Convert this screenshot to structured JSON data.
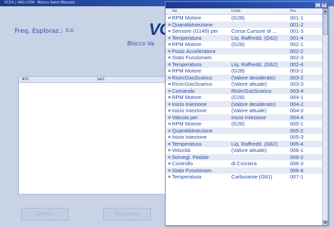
{
  "main": {
    "title": "VCDS | VAG-COM - Blocco Valori Misurati",
    "freq_label": "Freq. Esploraz.:",
    "freq_value": "0.0",
    "brand_text": "VC",
    "block_label": "Blocco Va",
    "table_headers": [
      "#01",
      "Val2"
    ],
    "button_left": "Grafico",
    "button_right": "Registrare"
  },
  "list_window": {
    "title": "",
    "close_icon": "×",
    "minimize_icon": "_",
    "columns": [
      "Val",
      "Unità",
      "Pos"
    ],
    "rows": [
      {
        "name": "RPM Motore",
        "value": "(G28)",
        "pos": "001-1"
      },
      {
        "name": "QuantitàIniezione",
        "value": "",
        "pos": "001-2"
      },
      {
        "name": "Sensore (G149) per",
        "value": "Corsa Cursore di ...",
        "pos": "001-3"
      },
      {
        "name": "Temperatura",
        "value": "Liq. Raffredd. (G62)",
        "pos": "001-4"
      },
      {
        "name": "RPM Motore",
        "value": "(G28)",
        "pos": "002-1"
      },
      {
        "name": "Posiz.Acceleratore",
        "value": "",
        "pos": "002-2"
      },
      {
        "name": "Stato Funzionam.",
        "value": "",
        "pos": "002-3"
      },
      {
        "name": "Temperatura",
        "value": "Liq. Raffredd. (G62)",
        "pos": "002-4"
      },
      {
        "name": "RPM Motore",
        "value": "(G28)",
        "pos": "003-1"
      },
      {
        "name": "RicircGasScarico",
        "value": "(Valore desiderato)",
        "pos": "003-2"
      },
      {
        "name": "RicircGasScarico",
        "value": "(Valore attuale)",
        "pos": "003-3"
      },
      {
        "name": "Comando",
        "value": "RicircGasScarico",
        "pos": "003-4"
      },
      {
        "name": "RPM Motore",
        "value": "(G28)",
        "pos": "004-1"
      },
      {
        "name": "Inizio Iniezione",
        "value": "(Valore desiderato)",
        "pos": "004-2"
      },
      {
        "name": "Inizio Iniezione",
        "value": "(Valore attuale)",
        "pos": "004-3"
      },
      {
        "name": "Valvola per",
        "value": "Inizio Iniezione",
        "pos": "004-4"
      },
      {
        "name": "RPM Motore",
        "value": "(G28)",
        "pos": "005-1"
      },
      {
        "name": "QuantitàIniezione",
        "value": "",
        "pos": "005-2"
      },
      {
        "name": "Inizio Iniezione",
        "value": "",
        "pos": "005-3"
      },
      {
        "name": "Temperatura",
        "value": "Liq. Raffredd. (G62)",
        "pos": "005-4"
      },
      {
        "name": "Velocità",
        "value": "(Valore attuale)",
        "pos": "006-1"
      },
      {
        "name": "Sorvegl. Pedale",
        "value": "",
        "pos": "006-2"
      },
      {
        "name": "Controllo",
        "value": "di Crociera",
        "pos": "006-3"
      },
      {
        "name": "Stato Funzionam.",
        "value": "",
        "pos": "006-4"
      },
      {
        "name": "Temperatura",
        "value": "Carburante (G81)",
        "pos": "007-1"
      }
    ]
  },
  "scrollbar": {
    "up_icon": "▲",
    "down_icon": "▼"
  }
}
